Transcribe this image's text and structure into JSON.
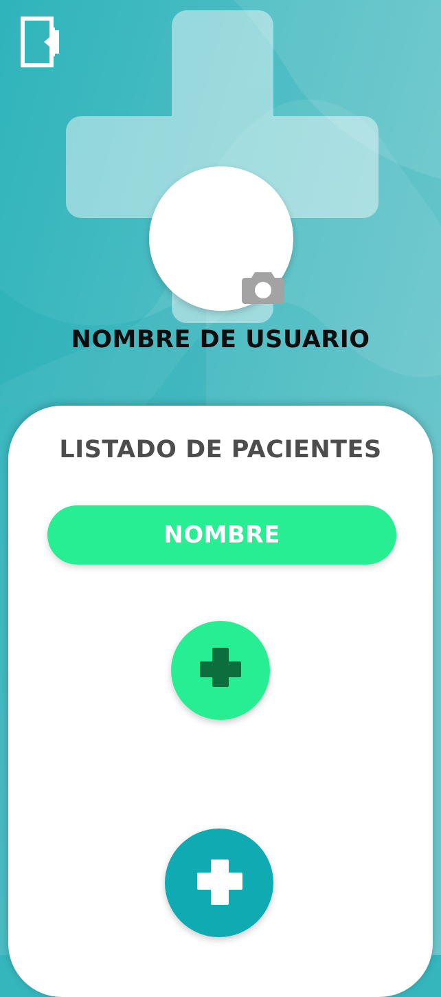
{
  "header": {
    "username": "NOMBRE DE USUARIO"
  },
  "patients": {
    "title": "LISTADO DE PACIENTES",
    "name_button_label": "NOMBRE"
  },
  "colors": {
    "background": "#35b6bd",
    "accent_green": "#28ee93",
    "dark_green_plus": "#0b6e3c",
    "teal_button": "#0faab2",
    "camera_gray": "#a3a3a3"
  },
  "icons": {
    "logout": "logout-door-icon",
    "camera": "camera-icon",
    "add_patient": "plus-icon",
    "add": "plus-icon"
  }
}
